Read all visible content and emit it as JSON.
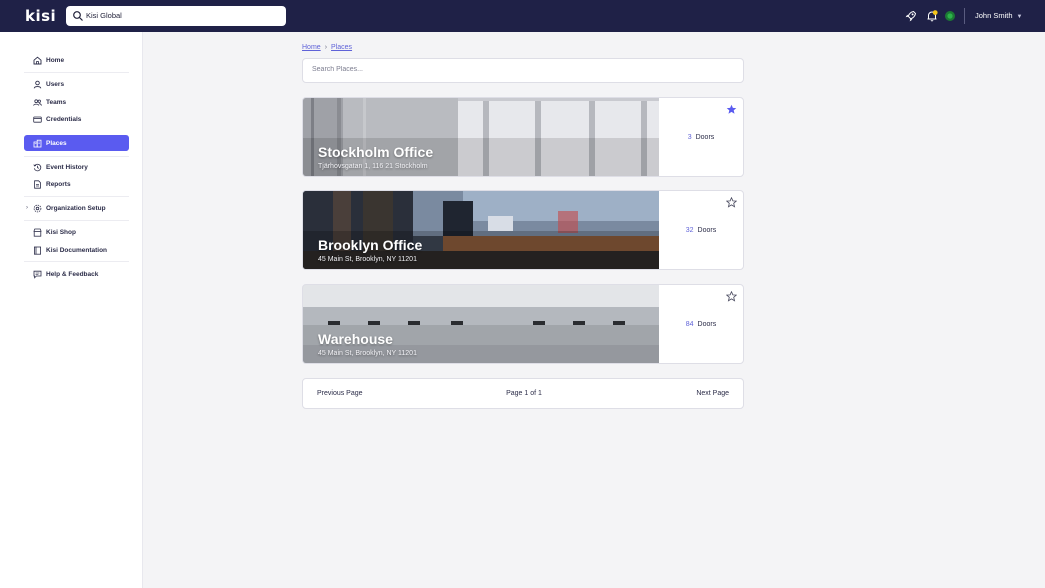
{
  "app": {
    "logo": "kisi"
  },
  "topbar": {
    "org_search_value": "Kisi Global",
    "user_name": "John Smith",
    "notification_color": "#f5c518",
    "status_color": "#2db34a"
  },
  "sidebar": {
    "items": [
      {
        "label": "Home",
        "icon": "home-icon"
      },
      {
        "label": "Users",
        "icon": "user-icon"
      },
      {
        "label": "Teams",
        "icon": "teams-icon"
      },
      {
        "label": "Credentials",
        "icon": "credential-card-icon"
      },
      {
        "label": "Places",
        "icon": "building-icon",
        "active": true
      },
      {
        "label": "Event History",
        "icon": "history-icon"
      },
      {
        "label": "Reports",
        "icon": "report-icon"
      },
      {
        "label": "Organization Setup",
        "icon": "gear-icon"
      },
      {
        "label": "Kisi Shop",
        "icon": "shop-icon"
      },
      {
        "label": "Kisi Documentation",
        "icon": "book-icon"
      },
      {
        "label": "Help & Feedback",
        "icon": "chat-icon"
      }
    ]
  },
  "breadcrumb": {
    "home": "Home",
    "separator": "›",
    "current": "Places"
  },
  "search": {
    "placeholder": "Search Places..."
  },
  "places": [
    {
      "name": "Stockholm Office",
      "address": "Tjärhovsgatan 1, 116 21 Stockholm",
      "doors_count": "3",
      "doors_label": "Doors",
      "starred": true
    },
    {
      "name": "Brooklyn Office",
      "address": "45 Main St, Brooklyn, NY 11201",
      "doors_count": "32",
      "doors_label": "Doors",
      "starred": false
    },
    {
      "name": "Warehouse",
      "address": "45 Main St, Brooklyn, NY 11201",
      "doors_count": "84",
      "doors_label": "Doors",
      "starred": false
    }
  ],
  "pagination": {
    "previous": "Previous Page",
    "info": "Page 1 of 1",
    "next": "Next Page"
  },
  "colors": {
    "accent": "#5a5bf0",
    "topbar": "#1f2147",
    "link": "#5f62d8"
  }
}
